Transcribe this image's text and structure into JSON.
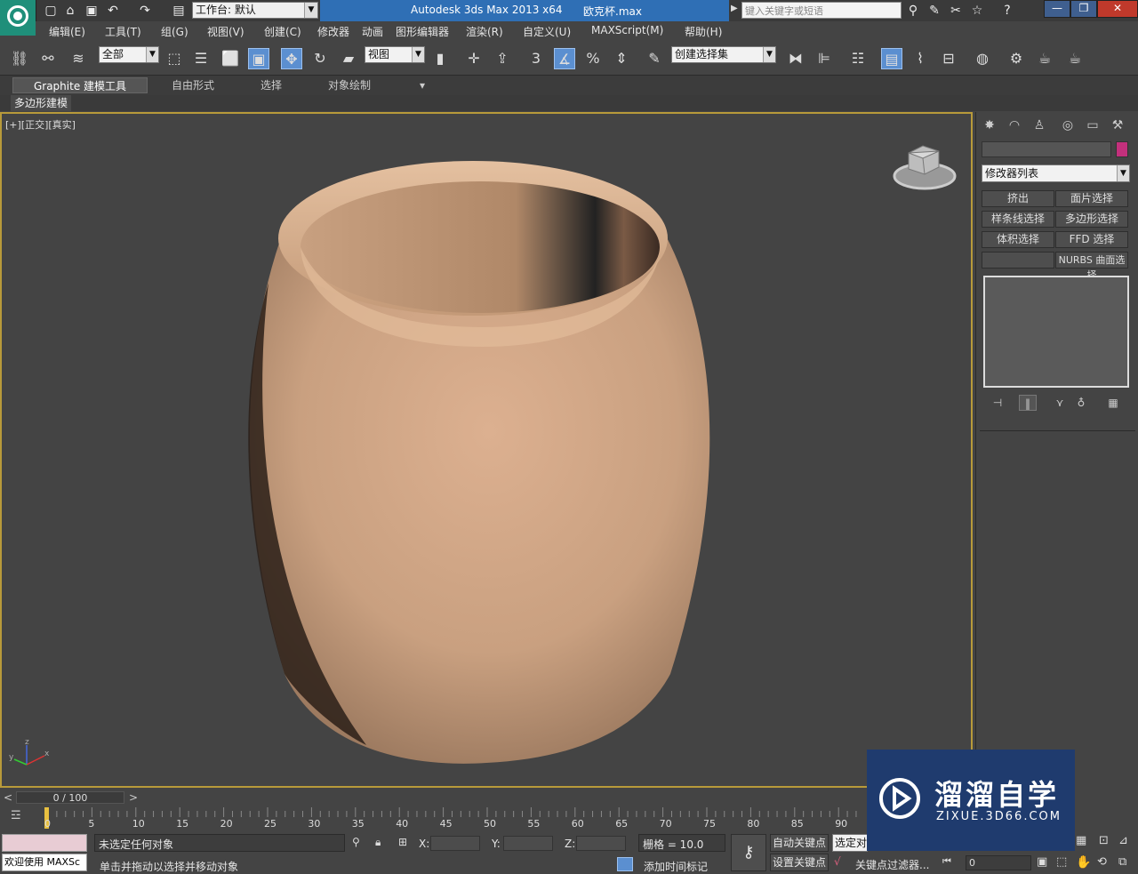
{
  "title_bar": {
    "workspace_label": "工作台: 默认",
    "app_title": "Autodesk 3ds Max  2013 x64",
    "file_name": "欧克杯.max",
    "search_placeholder": "键入关键字或短语",
    "help_label": "?",
    "window_buttons": [
      "—",
      "❐",
      "✕"
    ]
  },
  "menu": [
    "编辑(E)",
    "工具(T)",
    "组(G)",
    "视图(V)",
    "创建(C)",
    "修改器",
    "动画",
    "图形编辑器",
    "渲染(R)",
    "自定义(U)",
    "MAXScript(M)",
    "帮助(H)"
  ],
  "toolbar": {
    "selection_filter": "全部",
    "ref_coord": "视图",
    "named_selection": "创建选择集",
    "snap_labels": [
      "3",
      "%"
    ]
  },
  "ribbon": {
    "tabs": [
      "Graphite 建模工具",
      "自由形式",
      "选择",
      "对象绘制"
    ],
    "selected_tab": "Graphite 建模工具",
    "sub_label": "多边形建模"
  },
  "viewport": {
    "label": "[+][正交][真实]",
    "object_color": "#d4a888",
    "axis_labels": [
      "x",
      "y",
      "z"
    ]
  },
  "command_panel": {
    "modifier_list": "修改器列表",
    "object_color": "#c3307c",
    "modifier_buttons": [
      "挤出",
      "面片选择",
      "样条线选择",
      "多边形选择",
      "体积选择",
      "FFD 选择",
      "",
      "NURBS 曲面选择"
    ]
  },
  "time_slider": {
    "frame_label": "0 / 100",
    "prev": "<",
    "next": ">",
    "ticks": [
      "0",
      "5",
      "10",
      "15",
      "20",
      "25",
      "30",
      "35",
      "40",
      "45",
      "50",
      "55",
      "60",
      "65",
      "70",
      "75",
      "80",
      "85",
      "90"
    ]
  },
  "status_bar": {
    "maxscript_listener": "欢迎使用 MAXSc",
    "selection_status": "未选定任何对象",
    "prompt": "单击并拖动以选择并移动对象",
    "x_label": "X:",
    "y_label": "Y:",
    "z_label": "Z:",
    "grid": "栅格 = 10.0",
    "add_time_tag": "添加时间标记",
    "auto_key": "自动关键点",
    "selected_set": "选定对",
    "set_key": "设置关键点",
    "key_filters": "关键点过滤器...",
    "frame_field": "0"
  },
  "watermark": {
    "brand": "溜溜自学",
    "url": "ZIXUE.3D66.COM"
  }
}
